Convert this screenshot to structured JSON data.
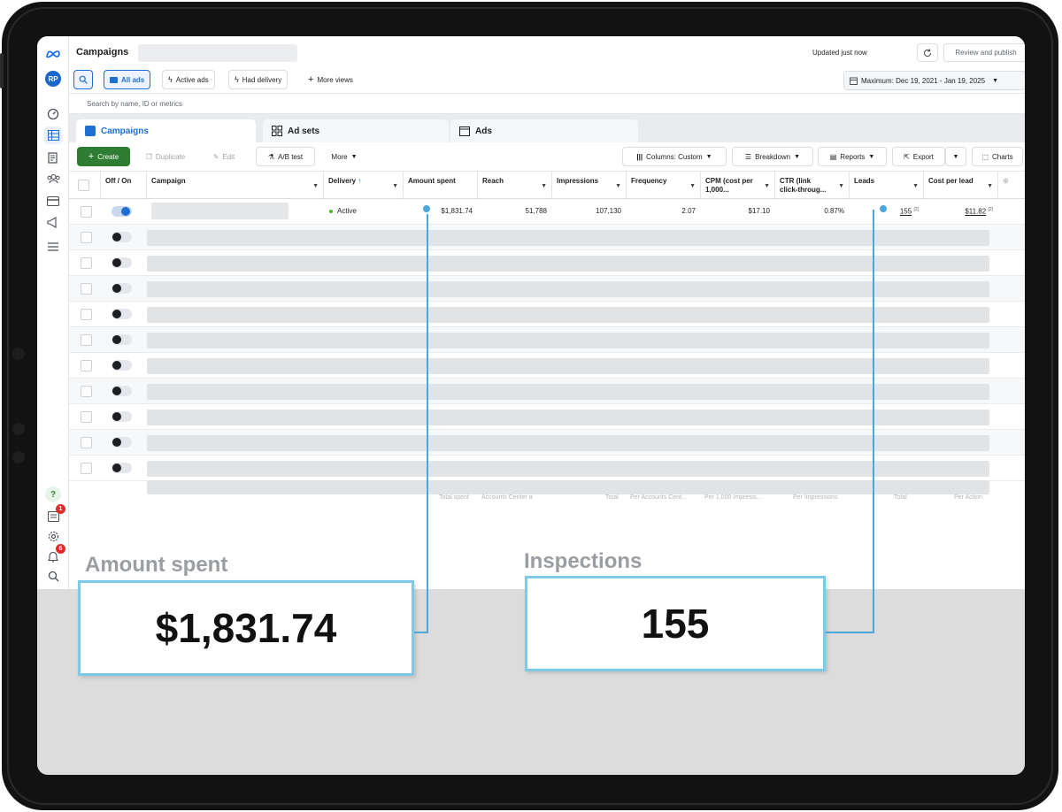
{
  "topbar": {
    "title": "Campaigns",
    "updated": "Updated just now",
    "review_publish": "Review and publish",
    "more": "···"
  },
  "views": {
    "all_ads": "All ads",
    "active_ads": "Active ads",
    "had_delivery": "Had delivery",
    "more_views": "More views",
    "date_range": "Maximum: Dec 19, 2021 - Jan 19, 2025"
  },
  "search": {
    "placeholder": "Search by name, ID or metrics"
  },
  "tabs": [
    "Campaigns",
    "Ad sets",
    "Ads"
  ],
  "toolbar": {
    "create": "Create",
    "duplicate": "Duplicate",
    "edit": "Edit",
    "ab_test": "A/B test",
    "more": "More",
    "columns": "Columns: Custom",
    "breakdown": "Breakdown",
    "reports": "Reports",
    "export": "Export",
    "charts": "Charts"
  },
  "columns": {
    "off_on": "Off / On",
    "campaign": "Campaign",
    "delivery": "Delivery",
    "amount_spent": "Amount spent",
    "reach": "Reach",
    "impressions": "Impressions",
    "frequency": "Frequency",
    "cpm_l1": "CPM (cost per",
    "cpm_l2": "1,000...",
    "ctr_l1": "CTR (link",
    "ctr_l2": "click-throug...",
    "leads": "Leads",
    "cost_per_lead": "Cost per lead"
  },
  "row1": {
    "delivery": "Active",
    "amount_spent": "$1,831.74",
    "reach": "51,788",
    "impressions": "107,130",
    "frequency": "2.07",
    "cpm": "$17.10",
    "ctr": "0.87%",
    "leads": "155",
    "leads_sup": "[2]",
    "cost_per_lead": "$11.82",
    "cpl_sup": "[2]"
  },
  "footer": {
    "total_spent": "Total spent",
    "accounts_center": "Accounts Center a",
    "total": "Total",
    "per_accounts": "Per Accounts Cent...",
    "per_1000": "Per 1,000 Impressi...",
    "per_impressions": "Per Impressions",
    "total2": "Total",
    "per_action": "Per Action"
  },
  "sidebar": {
    "badge_1": "1",
    "badge_2": "6"
  },
  "callouts": {
    "amount_label": "Amount spent",
    "amount_value": "$1,831.74",
    "inspections_label": "Inspections",
    "inspections_value": "155"
  }
}
